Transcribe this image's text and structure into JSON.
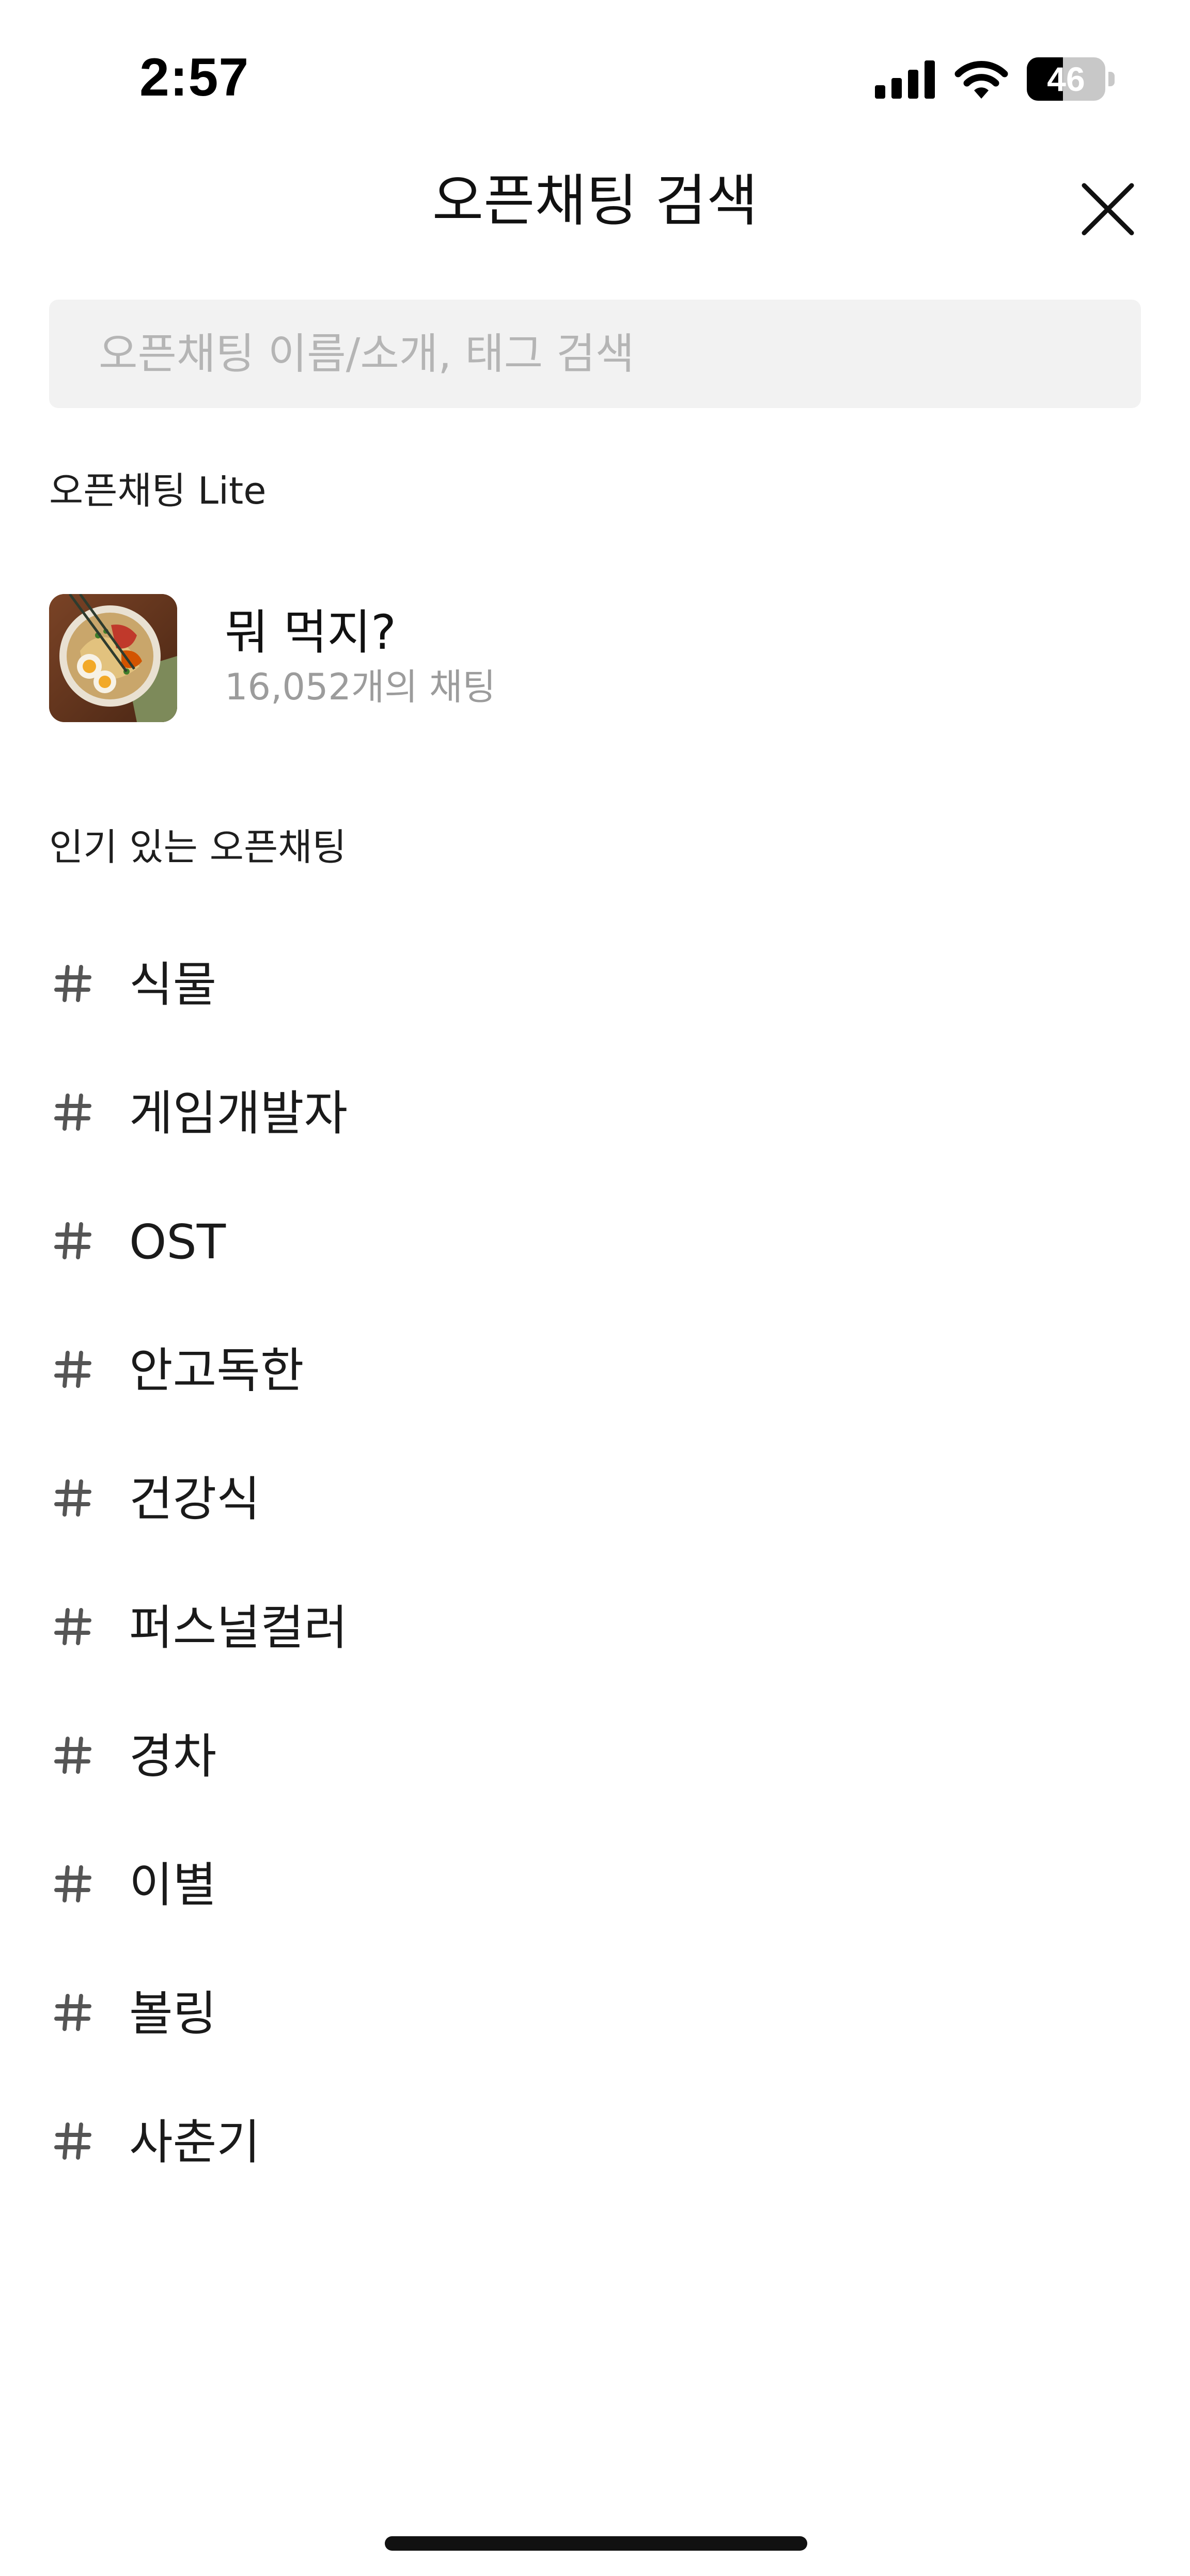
{
  "status_bar": {
    "time": "2:57",
    "battery_percent": "46",
    "battery_level": 0.46,
    "icons": [
      "cellular-signal-icon",
      "wifi-icon",
      "battery-icon"
    ]
  },
  "header": {
    "title": "오픈채팅 검색",
    "close_icon": "close-icon"
  },
  "search": {
    "value": "",
    "placeholder": "오픈채팅 이름/소개, 태그 검색"
  },
  "lite_section": {
    "title": "오픈채팅 Lite",
    "items": [
      {
        "name": "뭐 먹지?",
        "count": "16,052개의 채팅",
        "thumbnail": "ramen-bowl-image"
      }
    ]
  },
  "popular_section": {
    "title": "인기 있는 오픈채팅",
    "tag_icon": "hash-icon",
    "tags": [
      {
        "label": "식물"
      },
      {
        "label": "게임개발자"
      },
      {
        "label": "OST"
      },
      {
        "label": "안고독한"
      },
      {
        "label": "건강식"
      },
      {
        "label": "퍼스널컬러"
      },
      {
        "label": "경차"
      },
      {
        "label": "이별"
      },
      {
        "label": "볼링"
      },
      {
        "label": "사춘기"
      }
    ]
  },
  "colors": {
    "background": "#ffffff",
    "text_primary": "#111111",
    "text_secondary": "#9c9c9c",
    "search_background": "#f2f2f2",
    "placeholder": "#b5b5b5",
    "icon_gray": "#555555"
  }
}
